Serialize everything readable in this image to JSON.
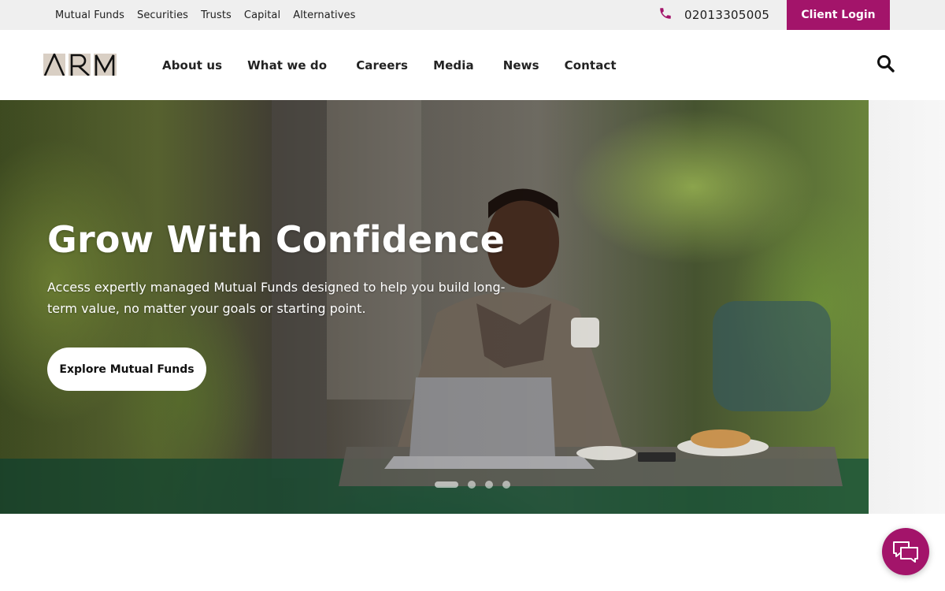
{
  "topbar": {
    "sub_links": [
      "Mutual Funds",
      "Securities",
      "Trusts",
      "Capital",
      "Alternatives"
    ],
    "phone_number": "02013305005",
    "phone_icon": "phone-icon",
    "client_login_label": "Client Login"
  },
  "brand": {
    "logo_text": "ARM"
  },
  "nav": {
    "items": [
      "About us",
      "What we do",
      "Careers",
      "Media",
      "News",
      "Contact"
    ],
    "search_icon": "search-icon"
  },
  "hero": {
    "title": "Grow With Confidence",
    "description": "Access expertly managed Mutual Funds designed to help you build long-term value, no matter your goals or starting point.",
    "cta_label": "Explore Mutual Funds",
    "slide_count": 4,
    "active_slide": 1
  },
  "chat": {
    "icon": "chat-bubbles-icon"
  },
  "colors": {
    "brand": "#a3146a",
    "topbar_bg": "#efefef",
    "text": "#1e1e1e"
  }
}
